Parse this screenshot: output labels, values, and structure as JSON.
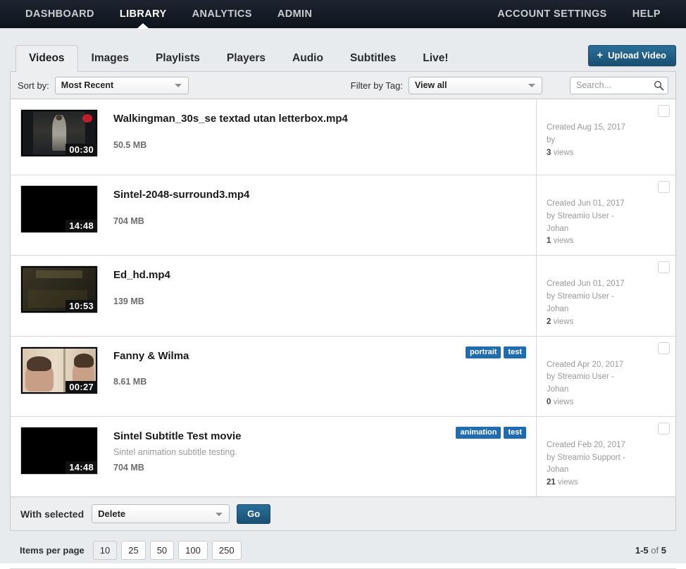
{
  "topnav": {
    "left_items": [
      {
        "label": "DASHBOARD",
        "active": false
      },
      {
        "label": "LIBRARY",
        "active": true
      },
      {
        "label": "ANALYTICS",
        "active": false
      },
      {
        "label": "ADMIN",
        "active": false
      }
    ],
    "right_items": [
      {
        "label": "ACCOUNT SETTINGS"
      },
      {
        "label": "HELP"
      }
    ]
  },
  "tabs": [
    {
      "label": "Videos",
      "active": true
    },
    {
      "label": "Images",
      "active": false
    },
    {
      "label": "Playlists",
      "active": false
    },
    {
      "label": "Players",
      "active": false
    },
    {
      "label": "Audio",
      "active": false
    },
    {
      "label": "Subtitles",
      "active": false
    },
    {
      "label": "Live!",
      "active": false
    }
  ],
  "upload": {
    "label": "Upload Video",
    "plus": "+",
    "icon": "plus-icon",
    "color": "#1f5f86"
  },
  "filters": {
    "sort_label": "Sort by:",
    "sort_value": "Most Recent",
    "tag_label": "Filter by Tag:",
    "tag_value": "View all",
    "search_placeholder": "Search...",
    "search_value": "",
    "search_icon": "search-icon"
  },
  "rows": [
    {
      "title": "Walkingman_30s_se textad utan letterbox.mp4",
      "subtitle": "",
      "size": "50.5 MB",
      "duration": "00:30",
      "tags": [],
      "created": "Created Aug 15, 2017",
      "by": "by",
      "by_cont": "",
      "views_count": "3",
      "views_label": "views",
      "thumb": "walkingman"
    },
    {
      "title": "Sintel-2048-surround3.mp4",
      "subtitle": "",
      "size": "704 MB",
      "duration": "14:48",
      "tags": [],
      "created": "Created Jun 01, 2017",
      "by": "by Streamio User -",
      "by_cont": "Johan",
      "views_count": "1",
      "views_label": "views",
      "thumb": "black"
    },
    {
      "title": "Ed_hd.mp4",
      "subtitle": "",
      "size": "139 MB",
      "duration": "10:53",
      "tags": [],
      "created": "Created Jun 01, 2017",
      "by": "by Streamio User -",
      "by_cont": "Johan",
      "views_count": "2",
      "views_label": "views",
      "thumb": "edhd"
    },
    {
      "title": "Fanny & Wilma",
      "subtitle": "",
      "size": "8.61 MB",
      "duration": "00:27",
      "tags": [
        "portrait",
        "test"
      ],
      "created": "Created Apr 20, 2017",
      "by": "by Streamio User -",
      "by_cont": "Johan",
      "views_count": "0",
      "views_label": "views",
      "thumb": "fanny"
    },
    {
      "title": "Sintel Subtitle Test movie",
      "subtitle": "Sintel animation subtitle testing.",
      "size": "704 MB",
      "duration": "14:48",
      "tags": [
        "animation",
        "test"
      ],
      "created": "Created Feb 20, 2017",
      "by": "by Streamio Support -",
      "by_cont": "Johan",
      "views_count": "21",
      "views_label": "views",
      "thumb": "black"
    }
  ],
  "bulk": {
    "label": "With selected",
    "action_value": "Delete",
    "go_label": "Go"
  },
  "footer": {
    "items_per_page_label": "Items per page",
    "page_sizes": [
      {
        "label": "10",
        "active": true
      },
      {
        "label": "25",
        "active": false
      },
      {
        "label": "50",
        "active": false
      },
      {
        "label": "100",
        "active": false
      },
      {
        "label": "250",
        "active": false
      }
    ],
    "range": "1-5",
    "of": "of",
    "total": "5"
  }
}
